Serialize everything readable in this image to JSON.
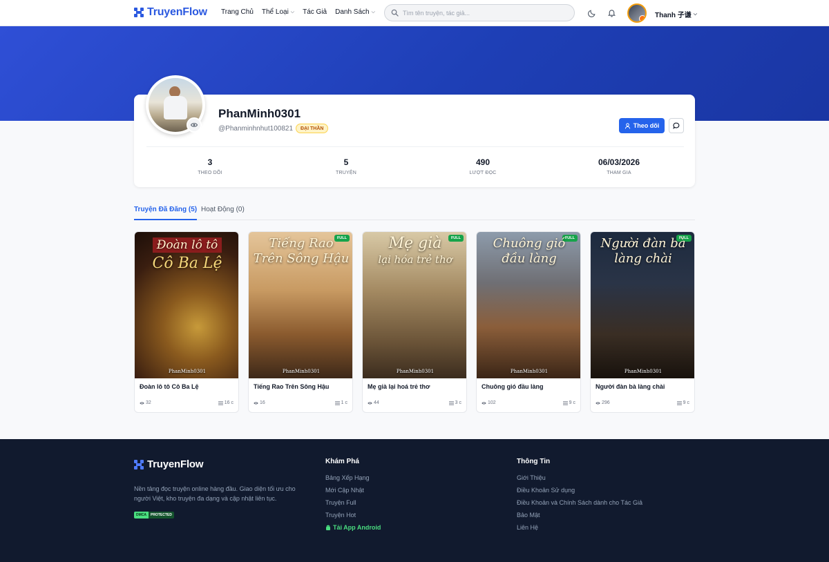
{
  "brand": {
    "name": "TruyenFlow",
    "color": "#2b59e0"
  },
  "nav": [
    {
      "label": "Trang Chủ",
      "dropdown": false
    },
    {
      "label": "Thể Loại",
      "dropdown": true
    },
    {
      "label": "Tác Giả",
      "dropdown": false
    },
    {
      "label": "Danh Sách",
      "dropdown": true
    }
  ],
  "search": {
    "placeholder": "Tìm tên truyện, tác giả...",
    "value": ""
  },
  "header": {
    "theme_icon": "moon-icon",
    "notify_icon": "bell-icon",
    "user_name": "Thanh 子谦"
  },
  "profile": {
    "name": "PhanMinh0301",
    "handle": "@Phanminhnhut100821",
    "rank": "ĐẠI THẦN",
    "follow_label": "Theo dõi",
    "message_icon": "chat-icon",
    "stats": [
      {
        "value": "3",
        "label": "THEO DÕI"
      },
      {
        "value": "5",
        "label": "TRUYỆN"
      },
      {
        "value": "490",
        "label": "LƯỢT ĐỌC"
      },
      {
        "value": "06/03/2026",
        "label": "THAM GIA"
      }
    ]
  },
  "tabs": [
    {
      "label": "Truyện Đã Đăng (5)",
      "active": true
    },
    {
      "label": "Hoạt Động (0)",
      "active": false
    }
  ],
  "books": [
    {
      "title": "Đoàn lô tô Cô Ba Lệ",
      "cover_line1": "Đoàn lô tô",
      "cover_line2": "Cô Ba Lệ",
      "author_mark": "PhanMinh0301",
      "full": false,
      "views": "32",
      "chapters": "16 c"
    },
    {
      "title": "Tiếng Rao Trên Sông Hậu",
      "cover_line1": "Tiếng Rao",
      "cover_line2": "Trên Sông Hậu",
      "author_mark": "PhanMinh0301",
      "full": true,
      "views": "16",
      "chapters": "1 c"
    },
    {
      "title": "Mẹ già lại hoá trẻ thơ",
      "cover_line1": "Mẹ già",
      "cover_line2": "lại hóa trẻ thơ",
      "author_mark": "PhanMinh0301",
      "full": true,
      "views": "44",
      "chapters": "3 c"
    },
    {
      "title": "Chuông gió đầu làng",
      "cover_line1": "Chuông gió",
      "cover_line2": "đầu làng",
      "author_mark": "PhanMinh0301",
      "full": true,
      "views": "102",
      "chapters": "9 c"
    },
    {
      "title": "Người đàn bà làng chài",
      "cover_line1": "Người đàn bà",
      "cover_line2": "làng chài",
      "author_mark": "PhanMinh0301",
      "full": true,
      "views": "296",
      "chapters": "9 c"
    }
  ],
  "full_badge": "FULL",
  "footer": {
    "brand": "TruyenFlow",
    "description": "Nền tảng đọc truyện online hàng đầu. Giao diện tối ưu cho người Việt, kho truyện đa dạng và cập nhật liên tục.",
    "dmca_left": "DMCA",
    "dmca_right": "PROTECTED",
    "explore_title": "Khám Phá",
    "explore_links": [
      "Bảng Xếp Hạng",
      "Mới Cập Nhật",
      "Truyện Full",
      "Truyện Hot"
    ],
    "app_link": "Tải App Android",
    "info_title": "Thông Tin",
    "info_links": [
      "Giới Thiệu",
      "Điều Khoản Sử dụng",
      "Điều Khoản và Chính Sách dành cho Tác Giả",
      "Bảo Mật",
      "Liên Hệ"
    ]
  }
}
